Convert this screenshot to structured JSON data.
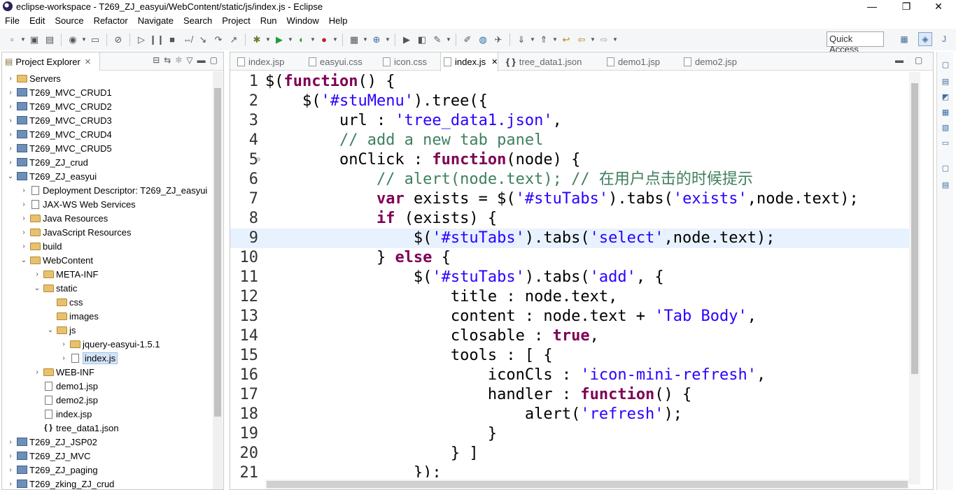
{
  "window": {
    "title": "eclipse-workspace - T269_ZJ_easyui/WebContent/static/js/index.js - Eclipse",
    "minimize": "—",
    "restore": "❐",
    "close": "✕"
  },
  "menu": [
    "File",
    "Edit",
    "Source",
    "Refactor",
    "Navigate",
    "Search",
    "Project",
    "Run",
    "Window",
    "Help"
  ],
  "toolbar": {
    "quick_access": "Quick Access"
  },
  "project_explorer": {
    "tab_label": "Project Explorer",
    "close": "✕",
    "tree": [
      {
        "label": "Servers",
        "indent": 0,
        "arrow": "›",
        "icon": "folder"
      },
      {
        "label": "T269_MVC_CRUD1",
        "indent": 0,
        "arrow": "›",
        "icon": "project"
      },
      {
        "label": "T269_MVC_CRUD2",
        "indent": 0,
        "arrow": "›",
        "icon": "project"
      },
      {
        "label": "T269_MVC_CRUD3",
        "indent": 0,
        "arrow": "›",
        "icon": "project"
      },
      {
        "label": "T269_MVC_CRUD4",
        "indent": 0,
        "arrow": "›",
        "icon": "project"
      },
      {
        "label": "T269_MVC_CRUD5",
        "indent": 0,
        "arrow": "›",
        "icon": "project"
      },
      {
        "label": "T269_ZJ_crud",
        "indent": 0,
        "arrow": "›",
        "icon": "project"
      },
      {
        "label": "T269_ZJ_easyui",
        "indent": 0,
        "arrow": "⌄",
        "icon": "project"
      },
      {
        "label": "Deployment Descriptor: T269_ZJ_easyui",
        "indent": 1,
        "arrow": "›",
        "icon": "file"
      },
      {
        "label": "JAX-WS Web Services",
        "indent": 1,
        "arrow": "›",
        "icon": "file"
      },
      {
        "label": "Java Resources",
        "indent": 1,
        "arrow": "›",
        "icon": "folder"
      },
      {
        "label": "JavaScript Resources",
        "indent": 1,
        "arrow": "›",
        "icon": "folder"
      },
      {
        "label": "build",
        "indent": 1,
        "arrow": "›",
        "icon": "folder"
      },
      {
        "label": "WebContent",
        "indent": 1,
        "arrow": "⌄",
        "icon": "folder"
      },
      {
        "label": "META-INF",
        "indent": 2,
        "arrow": "›",
        "icon": "folder"
      },
      {
        "label": "static",
        "indent": 2,
        "arrow": "⌄",
        "icon": "folder"
      },
      {
        "label": "css",
        "indent": 3,
        "arrow": "",
        "icon": "folder"
      },
      {
        "label": "images",
        "indent": 3,
        "arrow": "",
        "icon": "folder"
      },
      {
        "label": "js",
        "indent": 3,
        "arrow": "⌄",
        "icon": "folder"
      },
      {
        "label": "jquery-easyui-1.5.1",
        "indent": 4,
        "arrow": "›",
        "icon": "folder"
      },
      {
        "label": "index.js",
        "indent": 4,
        "arrow": "›",
        "icon": "file",
        "selected": true
      },
      {
        "label": "WEB-INF",
        "indent": 2,
        "arrow": "›",
        "icon": "folder"
      },
      {
        "label": "demo1.jsp",
        "indent": 2,
        "arrow": "",
        "icon": "file"
      },
      {
        "label": "demo2.jsp",
        "indent": 2,
        "arrow": "",
        "icon": "file"
      },
      {
        "label": "index.jsp",
        "indent": 2,
        "arrow": "",
        "icon": "file"
      },
      {
        "label": "tree_data1.json",
        "indent": 2,
        "arrow": "",
        "icon": "json"
      },
      {
        "label": "T269_ZJ_JSP02",
        "indent": 0,
        "arrow": "›",
        "icon": "project"
      },
      {
        "label": "T269_ZJ_MVC",
        "indent": 0,
        "arrow": "›",
        "icon": "project"
      },
      {
        "label": "T269_ZJ_paging",
        "indent": 0,
        "arrow": "›",
        "icon": "project"
      },
      {
        "label": "T269_zking_ZJ_crud",
        "indent": 0,
        "arrow": "›",
        "icon": "project"
      }
    ]
  },
  "editor": {
    "tabs": [
      {
        "label": "index.jsp",
        "active": false
      },
      {
        "label": "easyui.css",
        "active": false
      },
      {
        "label": "icon.css",
        "active": false
      },
      {
        "label": "index.js",
        "active": true
      },
      {
        "label": "tree_data1.json",
        "active": false,
        "json": true
      },
      {
        "label": "demo1.jsp",
        "active": false
      },
      {
        "label": "demo2.jsp",
        "active": false
      }
    ],
    "current_line": 9,
    "lines": [
      [
        [
          "p",
          "$("
        ],
        [
          "k",
          "function"
        ],
        [
          "p",
          "() {"
        ]
      ],
      [
        [
          "p",
          "    $("
        ],
        [
          "s",
          "'#stuMenu'"
        ],
        [
          "p",
          ").tree({"
        ]
      ],
      [
        [
          "p",
          "        url : "
        ],
        [
          "s",
          "'tree_data1.json'"
        ],
        [
          "p",
          ","
        ]
      ],
      [
        [
          "c",
          "        // add a new tab panel"
        ]
      ],
      [
        [
          "p",
          "        onClick : "
        ],
        [
          "k",
          "function"
        ],
        [
          "p",
          "(node) {"
        ]
      ],
      [
        [
          "c",
          "            // alert(node.text); // 在用户点击的时候提示"
        ]
      ],
      [
        [
          "p",
          "            "
        ],
        [
          "k",
          "var"
        ],
        [
          "p",
          " exists = $("
        ],
        [
          "s",
          "'#stuTabs'"
        ],
        [
          "p",
          ").tabs("
        ],
        [
          "s",
          "'exists'"
        ],
        [
          "p",
          ",node.text);"
        ]
      ],
      [
        [
          "p",
          "            "
        ],
        [
          "k",
          "if"
        ],
        [
          "p",
          " (exists) {"
        ]
      ],
      [
        [
          "p",
          "                $("
        ],
        [
          "s",
          "'#stuTabs'"
        ],
        [
          "p",
          ").tabs("
        ],
        [
          "s",
          "'select'"
        ],
        [
          "p",
          ",node.text);"
        ]
      ],
      [
        [
          "p",
          "            } "
        ],
        [
          "k",
          "else"
        ],
        [
          "p",
          " {"
        ]
      ],
      [
        [
          "p",
          "                $("
        ],
        [
          "s",
          "'#stuTabs'"
        ],
        [
          "p",
          ").tabs("
        ],
        [
          "s",
          "'add'"
        ],
        [
          "p",
          ", {"
        ]
      ],
      [
        [
          "p",
          "                    title : node.text,"
        ]
      ],
      [
        [
          "p",
          "                    content : node.text + "
        ],
        [
          "s",
          "'Tab Body'"
        ],
        [
          "p",
          ","
        ]
      ],
      [
        [
          "p",
          "                    closable : "
        ],
        [
          "k",
          "true"
        ],
        [
          "p",
          ","
        ]
      ],
      [
        [
          "p",
          "                    tools : [ {"
        ]
      ],
      [
        [
          "p",
          "                        iconCls : "
        ],
        [
          "s",
          "'icon-mini-refresh'"
        ],
        [
          "p",
          ","
        ]
      ],
      [
        [
          "p",
          "                        handler : "
        ],
        [
          "k",
          "function"
        ],
        [
          "p",
          "() {"
        ]
      ],
      [
        [
          "p",
          "                            alert("
        ],
        [
          "s",
          "'refresh'"
        ],
        [
          "p",
          ");"
        ]
      ],
      [
        [
          "p",
          "                        }"
        ]
      ],
      [
        [
          "p",
          "                    } ]"
        ]
      ],
      [
        [
          "p",
          "                });"
        ]
      ]
    ]
  }
}
